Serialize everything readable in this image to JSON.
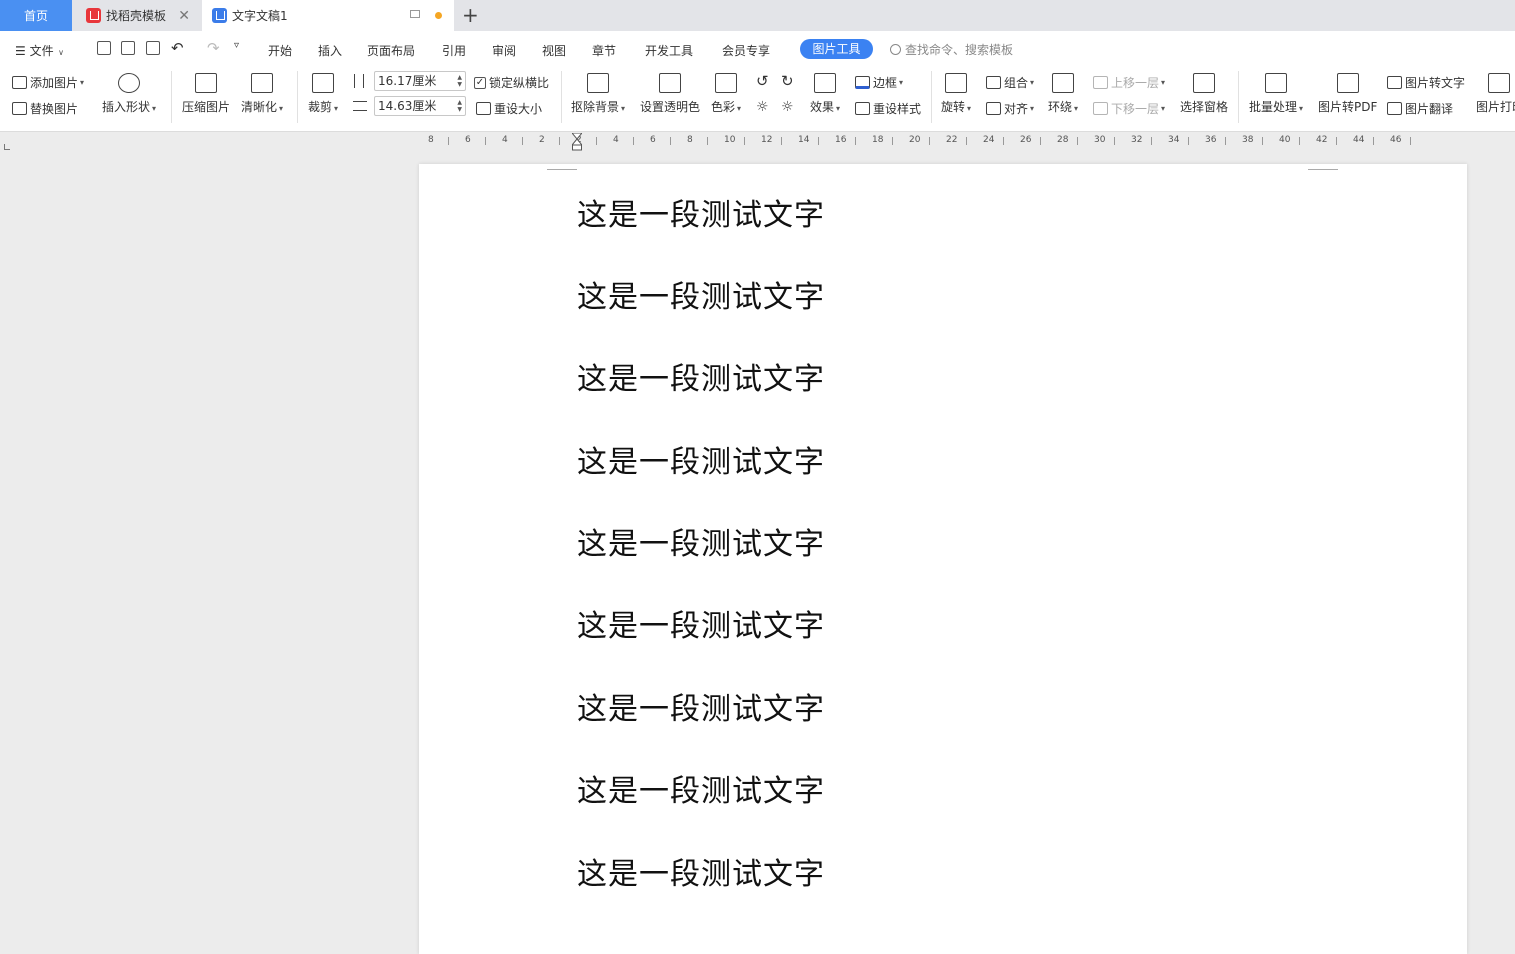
{
  "tabs": {
    "home": "首页",
    "template": "找稻壳模板",
    "document": "文字文稿1"
  },
  "menu": {
    "file": "文件",
    "items": [
      "开始",
      "插入",
      "页面布局",
      "引用",
      "审阅",
      "视图",
      "章节",
      "开发工具",
      "会员专享"
    ],
    "active": "图片工具",
    "search_placeholder": "查找命令、搜索模板"
  },
  "ribbon": {
    "add_picture": "添加图片",
    "replace_picture": "替换图片",
    "insert_shape": "插入形状",
    "compress_picture": "压缩图片",
    "sharpen": "清晰化",
    "crop": "裁剪",
    "width_value": "16.17厘米",
    "height_value": "14.63厘米",
    "lock_ratio": "锁定纵横比",
    "lock_ratio_checked": true,
    "reset_size": "重设大小",
    "remove_background": "抠除背景",
    "set_transparent": "设置透明色",
    "color": "色彩",
    "effects": "效果",
    "border": "边框",
    "reset_style": "重设样式",
    "rotate": "旋转",
    "group": "组合",
    "align": "对齐",
    "wrap": "环绕",
    "bring_forward": "上移一层",
    "send_backward": "下移一层",
    "selection_pane": "选择窗格",
    "batch_process": "批量处理",
    "to_pdf": "图片转PDF",
    "to_text": "图片转文字",
    "translate": "图片翻译",
    "print": "图片打印"
  },
  "ruler": {
    "ticks": [
      "8",
      "6",
      "4",
      "2",
      "2",
      "4",
      "6",
      "8",
      "10",
      "12",
      "14",
      "16",
      "18",
      "20",
      "22",
      "24",
      "26",
      "28",
      "30",
      "32",
      "34",
      "36",
      "38",
      "40",
      "42",
      "44",
      "46"
    ]
  },
  "document": {
    "lines": [
      "这是一段测试文字",
      "这是一段测试文字",
      "这是一段测试文字",
      "这是一段测试文字",
      "这是一段测试文字",
      "这是一段测试文字",
      "这是一段测试文字",
      "这是一段测试文字",
      "这是一段测试文字"
    ]
  },
  "colors": {
    "accent": "#3b82f2",
    "home_tab": "#4a90f2",
    "unsaved_dot": "#f5a623"
  }
}
